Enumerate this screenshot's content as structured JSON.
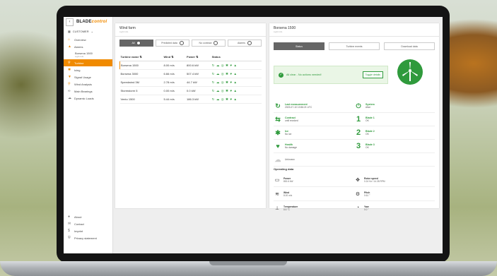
{
  "sidebar": {
    "logo_main": "BLADE",
    "logo_accent": "control",
    "back": "‹",
    "customer": "CUSTOMER",
    "items": [
      {
        "label": "Overview",
        "icon": "home-icon"
      },
      {
        "label": "Alarms",
        "icon": "bell-icon"
      },
      {
        "label": "Borsena 1500",
        "sub": "Light Info",
        "icon": "turbine-small-icon"
      },
      {
        "label": "Turbine",
        "icon": "search-icon",
        "active": true
      },
      {
        "label": "Icing",
        "icon": "ice-icon"
      },
      {
        "label": "Signal Usage",
        "icon": "filter-icon"
      },
      {
        "label": "Wind Analysis",
        "icon": "search-icon"
      },
      {
        "label": "Main Bearings",
        "icon": "bearing-icon"
      },
      {
        "label": "Dynamic Loads",
        "icon": "cloud-icon"
      }
    ],
    "bottom": [
      "About",
      "Contact",
      "Imprint",
      "Privacy statement"
    ]
  },
  "wind_farm": {
    "title": "Wind farm",
    "subtitle": "Light Info",
    "filters": [
      "All",
      "Predicted data",
      "No contract",
      "Alarms"
    ],
    "columns": [
      "Turbine name",
      "Wind",
      "Power",
      "Status"
    ],
    "rows": [
      {
        "name": "Borsena 1500",
        "wind": "8.00 m/s",
        "power": "800.6 kW",
        "status": "↻ ☁ ◎ ✱ ♥ ▲"
      },
      {
        "name": "Borsena 3000",
        "wind": "6.66 m/s",
        "power": "507.4 kW",
        "status": "↻ ☁ ◎ ✱ ♥ ▲"
      },
      {
        "name": "Speedwind 3M",
        "wind": "2.78 m/s",
        "power": "44.7 kW",
        "status": "↻ ☁ ◎ ✱ ♥ ▲"
      },
      {
        "name": "Stormstorm 5",
        "wind": "0.00 m/s",
        "power": "0.0 kW",
        "status": "↻ ☁ ◎ ✱ ♥ ▲"
      },
      {
        "name": "Vento 1500",
        "wind": "5.44 m/s",
        "power": "186.3 kW",
        "status": "↻ ☁ ◎ ✱ ♥ ▲"
      }
    ]
  },
  "detail": {
    "title": "Borsena 1500",
    "subtitle": "Light Info",
    "tabs": [
      "Status",
      "Turbine events",
      "Download data"
    ],
    "alert_msg": "All clear - No actions needed!",
    "alert_btn": "Toggle details",
    "status": [
      {
        "title": "Last measurement",
        "value": "2023-07-10 13:56:21 UTC",
        "icon": "↻"
      },
      {
        "title": "System",
        "value": "Alive",
        "icon": "⏻"
      },
      {
        "title": "Contract",
        "value": "until revoked",
        "icon": "⇆"
      },
      {
        "title": "Blade 1",
        "value": "OK",
        "icon": "1"
      },
      {
        "title": "Ice",
        "value": "No ice",
        "icon": "✱"
      },
      {
        "title": "Blade 2",
        "value": "OK",
        "icon": "2"
      },
      {
        "title": "Health",
        "value": "No damage",
        "icon": "♥"
      },
      {
        "title": "Blade 3",
        "value": "OK",
        "icon": "3"
      },
      {
        "title": "",
        "value": "Unknown",
        "icon": "☁"
      }
    ],
    "op_title": "Operating data",
    "operating": [
      {
        "title": "Power",
        "value": "800.6 kW",
        "icon": "▭"
      },
      {
        "title": "Rotor speed",
        "value": "0.24 Hz / 14.35 RPM",
        "icon": "✥"
      },
      {
        "title": "Wind",
        "value": "8.00 m/s",
        "icon": "≋"
      },
      {
        "title": "Pitch",
        "value": "0.61 °",
        "icon": "⚙"
      },
      {
        "title": "Temperature",
        "value": "8.6 °C",
        "icon": "⊥"
      },
      {
        "title": "Yaw",
        "value": "0.0 °",
        "icon": "◔"
      }
    ]
  },
  "colors": {
    "accent": "#f08a00",
    "ok": "#2f9a3c"
  }
}
